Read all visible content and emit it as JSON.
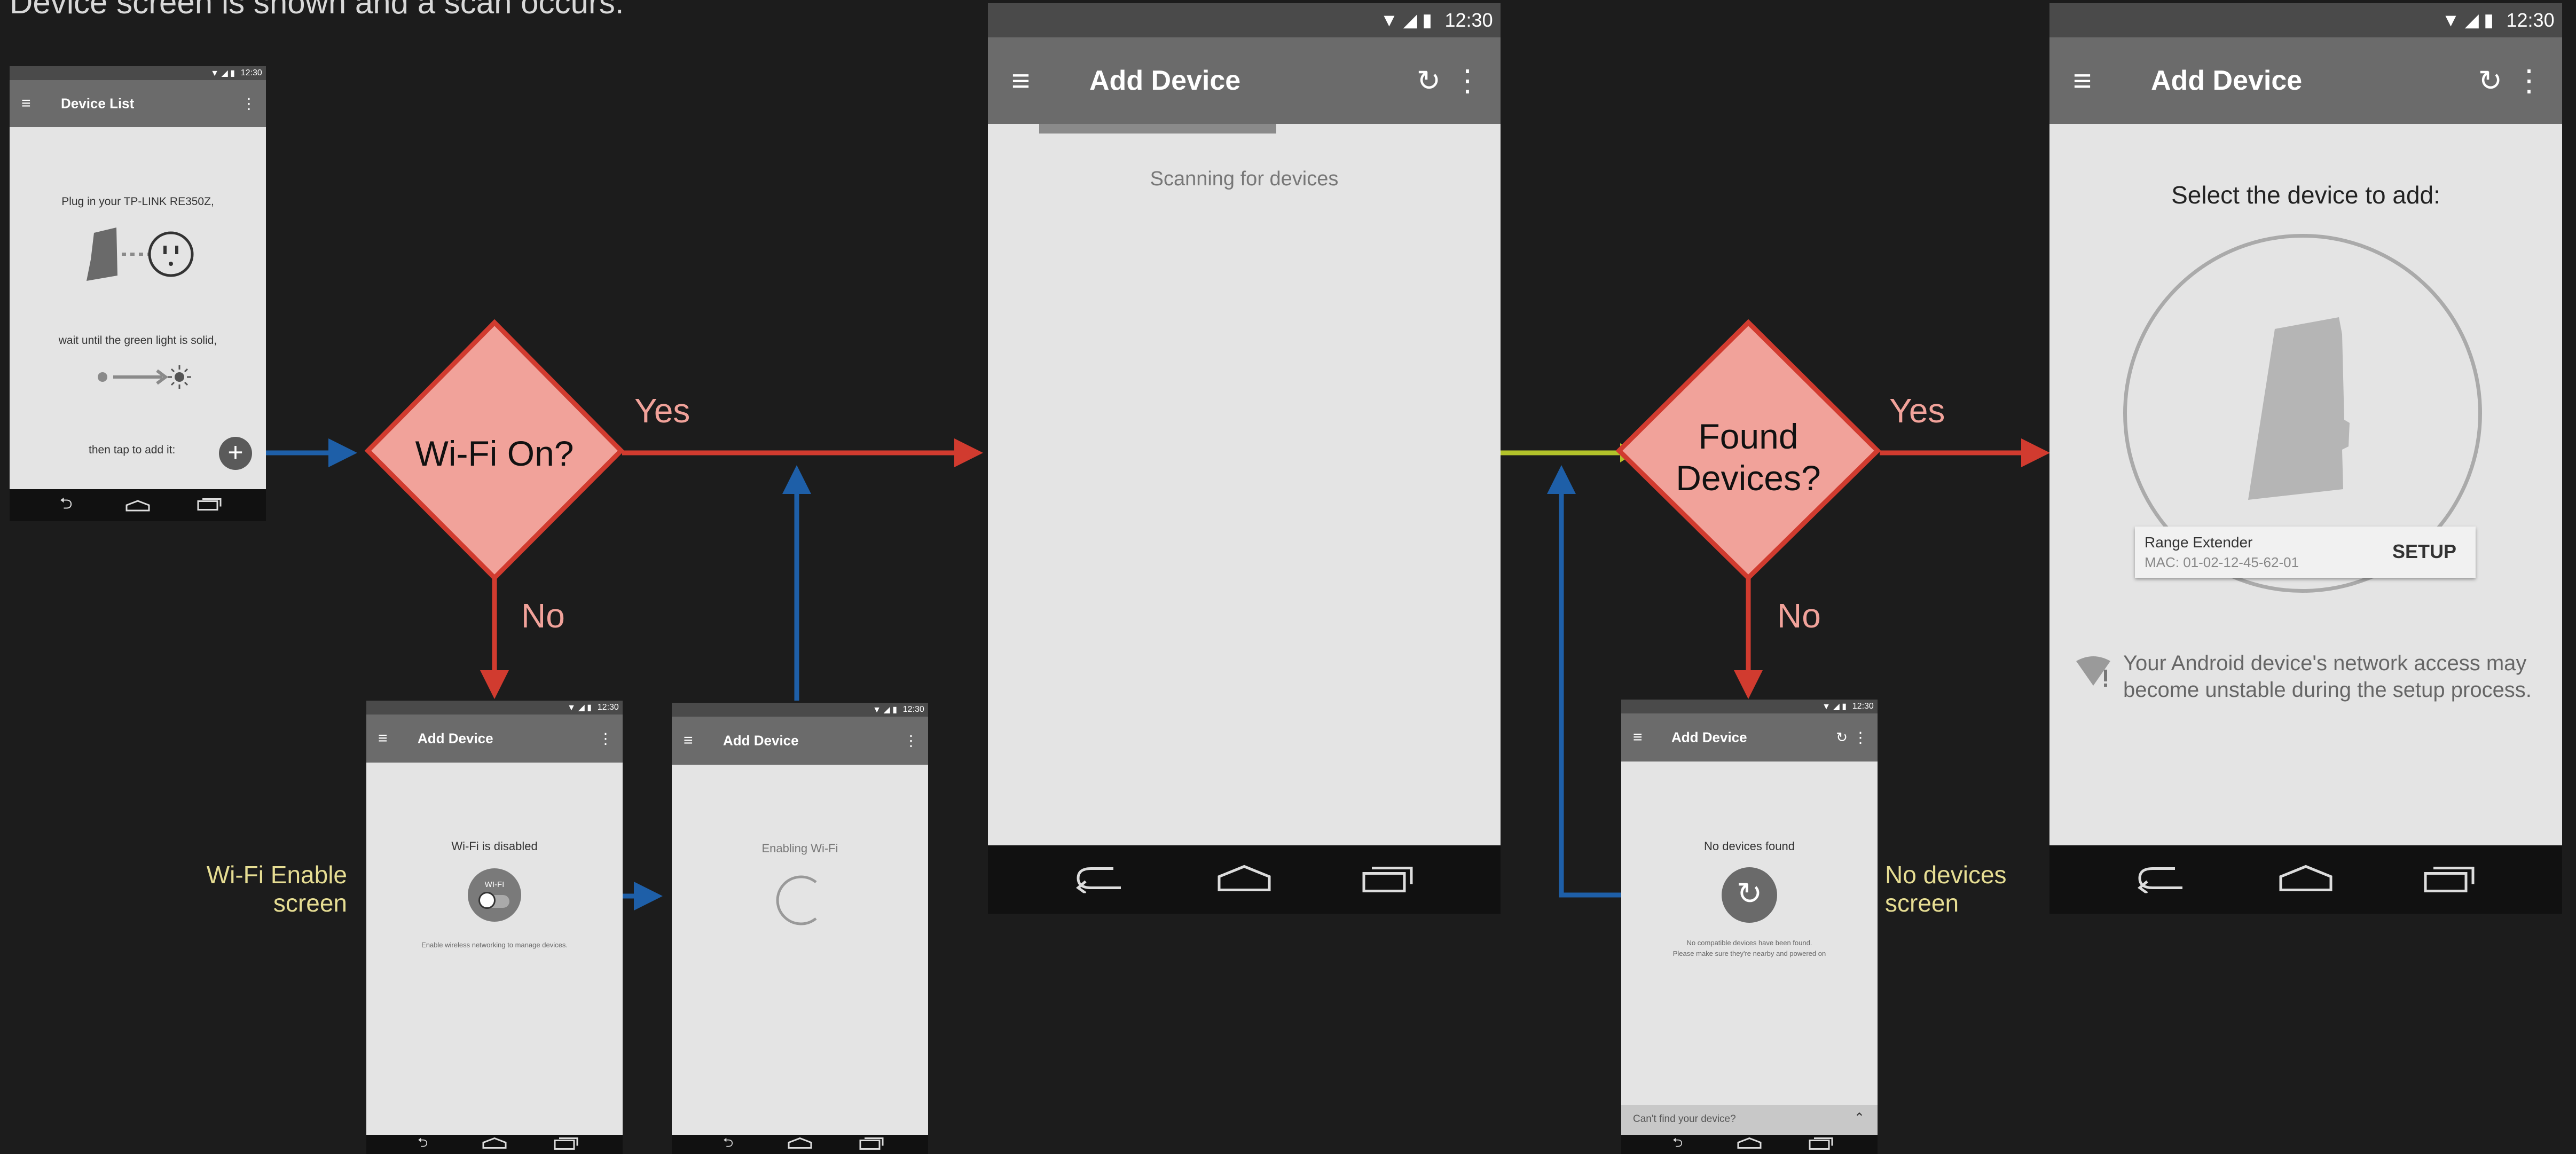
{
  "caption": "Device screen is shown and a scan occurs.",
  "status_time": "12:30",
  "decisions": {
    "wifi": {
      "label": "Wi-Fi On?",
      "yes": "Yes",
      "no": "No"
    },
    "found": {
      "label_line1": "Found",
      "label_line2": "Devices?",
      "yes": "Yes",
      "no": "No"
    }
  },
  "side_labels": {
    "wifi_enable_line1": "Wi-Fi Enable",
    "wifi_enable_line2": "screen",
    "no_devices_line1": "No devices",
    "no_devices_line2": "screen"
  },
  "device_list_screen": {
    "title": "Device List",
    "step1": "Plug in your TP-LINK RE350Z,",
    "step2": "wait until the green light is solid,",
    "step3": "then tap to add it:"
  },
  "wifi_disabled_screen": {
    "title": "Add Device",
    "message": "Wi-Fi is disabled",
    "toggle_label": "WI-FI",
    "hint": "Enable wireless networking to manage devices."
  },
  "enabling_screen": {
    "title": "Add Device",
    "message": "Enabling Wi-Fi"
  },
  "scanning_screen": {
    "title": "Add Device",
    "message": "Scanning for devices"
  },
  "no_devices_screen": {
    "title": "Add Device",
    "message": "No devices found",
    "hint_line1": "No compatible devices have been found.",
    "hint_line2": "Please make sure they're nearby and powered on",
    "footer": "Can't find your device?"
  },
  "select_screen": {
    "title": "Add Device",
    "heading": "Select the device to add:",
    "device_name": "Range Extender",
    "device_mac": "MAC: 01-02-12-45-62-01",
    "setup_label": "SETUP",
    "warning_line1": "Your Android device's network access may",
    "warning_line2": "become unstable during the setup process."
  },
  "colors": {
    "background": "#1c1c1c",
    "decision_fill": "#f1a29a",
    "decision_stroke": "#d13b2f",
    "arrow_red": "#d13b2f",
    "arrow_blue": "#1e5fa8",
    "arrow_yellow": "#b2c22a",
    "side_label": "#e6dd93",
    "screen_bg": "#e4e4e4",
    "app_bar": "#6b6b6b",
    "status_bar": "#4a4a4a"
  }
}
